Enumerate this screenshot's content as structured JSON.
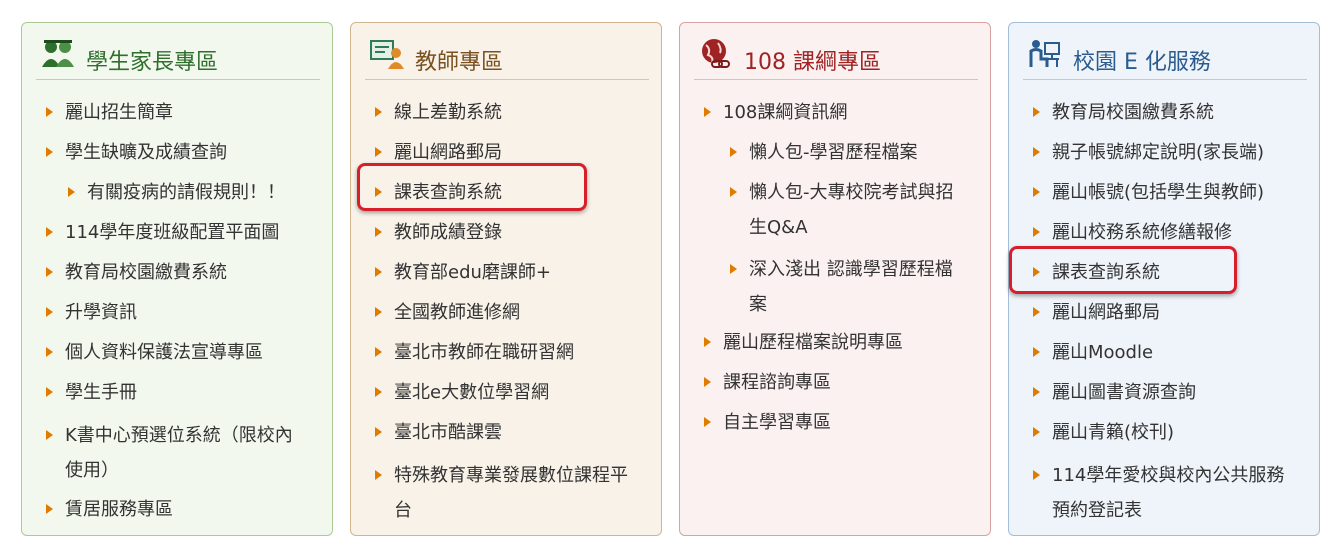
{
  "panels": [
    {
      "title": "學生家長專區",
      "icon": "students-parents-icon",
      "items": [
        "麗山招生簡章",
        "學生缺曠及成績查詢",
        "有關疫病的請假規則！！",
        "114學年度班級配置平面圖",
        "教育局校園繳費系統",
        "升學資訊",
        "個人資料保護法宣導專區",
        "學生手冊",
        "K書中心預選位系統（限校內使用）",
        "賃居服務專區"
      ]
    },
    {
      "title": "教師專區",
      "icon": "teacher-icon",
      "items": [
        "線上差勤系統",
        "麗山網路郵局",
        "課表查詢系統",
        "教師成績登錄",
        "教育部edu磨課師+",
        "全國教師進修網",
        "臺北市教師在職研習網",
        "臺北e大數位學習網",
        "臺北市酷課雲",
        "特殊教育專業發展數位課程平台"
      ]
    },
    {
      "title": "108 課綱專區",
      "icon": "globe-link-icon",
      "items": [
        "108課綱資訊網",
        "懶人包-學習歷程檔案",
        "懶人包-大專校院考試與招生Q&A",
        "深入淺出 認識學習歷程檔案",
        "麗山歷程檔案說明專區",
        "課程諮詢專區",
        "自主學習專區"
      ]
    },
    {
      "title": "校園 E 化服務",
      "icon": "computer-user-icon",
      "items": [
        "教育局校園繳費系統",
        "親子帳號綁定說明(家長端)",
        "麗山帳號(包括學生與教師)",
        "麗山校務系統修繕報修",
        "課表查詢系統",
        "麗山網路郵局",
        "麗山Moodle",
        "麗山圖書資源查詢",
        "麗山青籟(校刊)",
        "114學年愛校與校內公共服務預約登記表"
      ]
    }
  ],
  "colors": {
    "arrow": "#e07b00",
    "highlight": "#d61f2b"
  }
}
